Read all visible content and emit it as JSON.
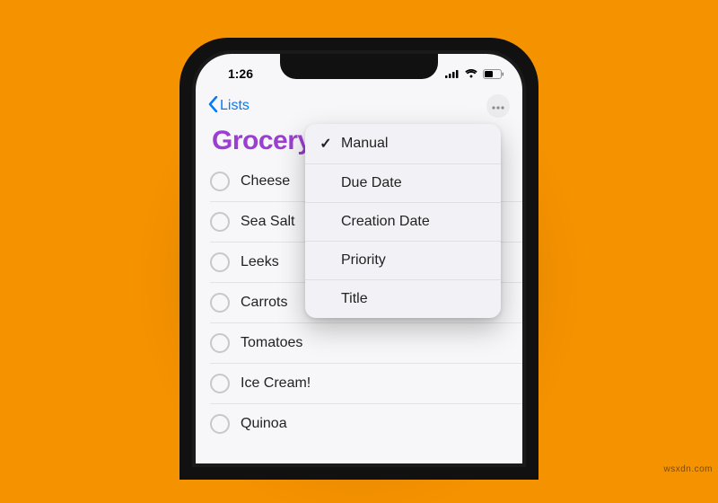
{
  "status": {
    "time": "1:26"
  },
  "nav": {
    "back_label": "Lists"
  },
  "list": {
    "title": "Grocery",
    "title_color": "#9b3fd1"
  },
  "reminders": [
    "Cheese",
    "Sea Salt",
    "Leeks",
    "Carrots",
    "Tomatoes",
    "Ice Cream!",
    "Quinoa"
  ],
  "sort_menu": {
    "selected_index": 0,
    "options": [
      "Manual",
      "Due Date",
      "Creation Date",
      "Priority",
      "Title"
    ]
  },
  "watermark": "wsxdn.com"
}
